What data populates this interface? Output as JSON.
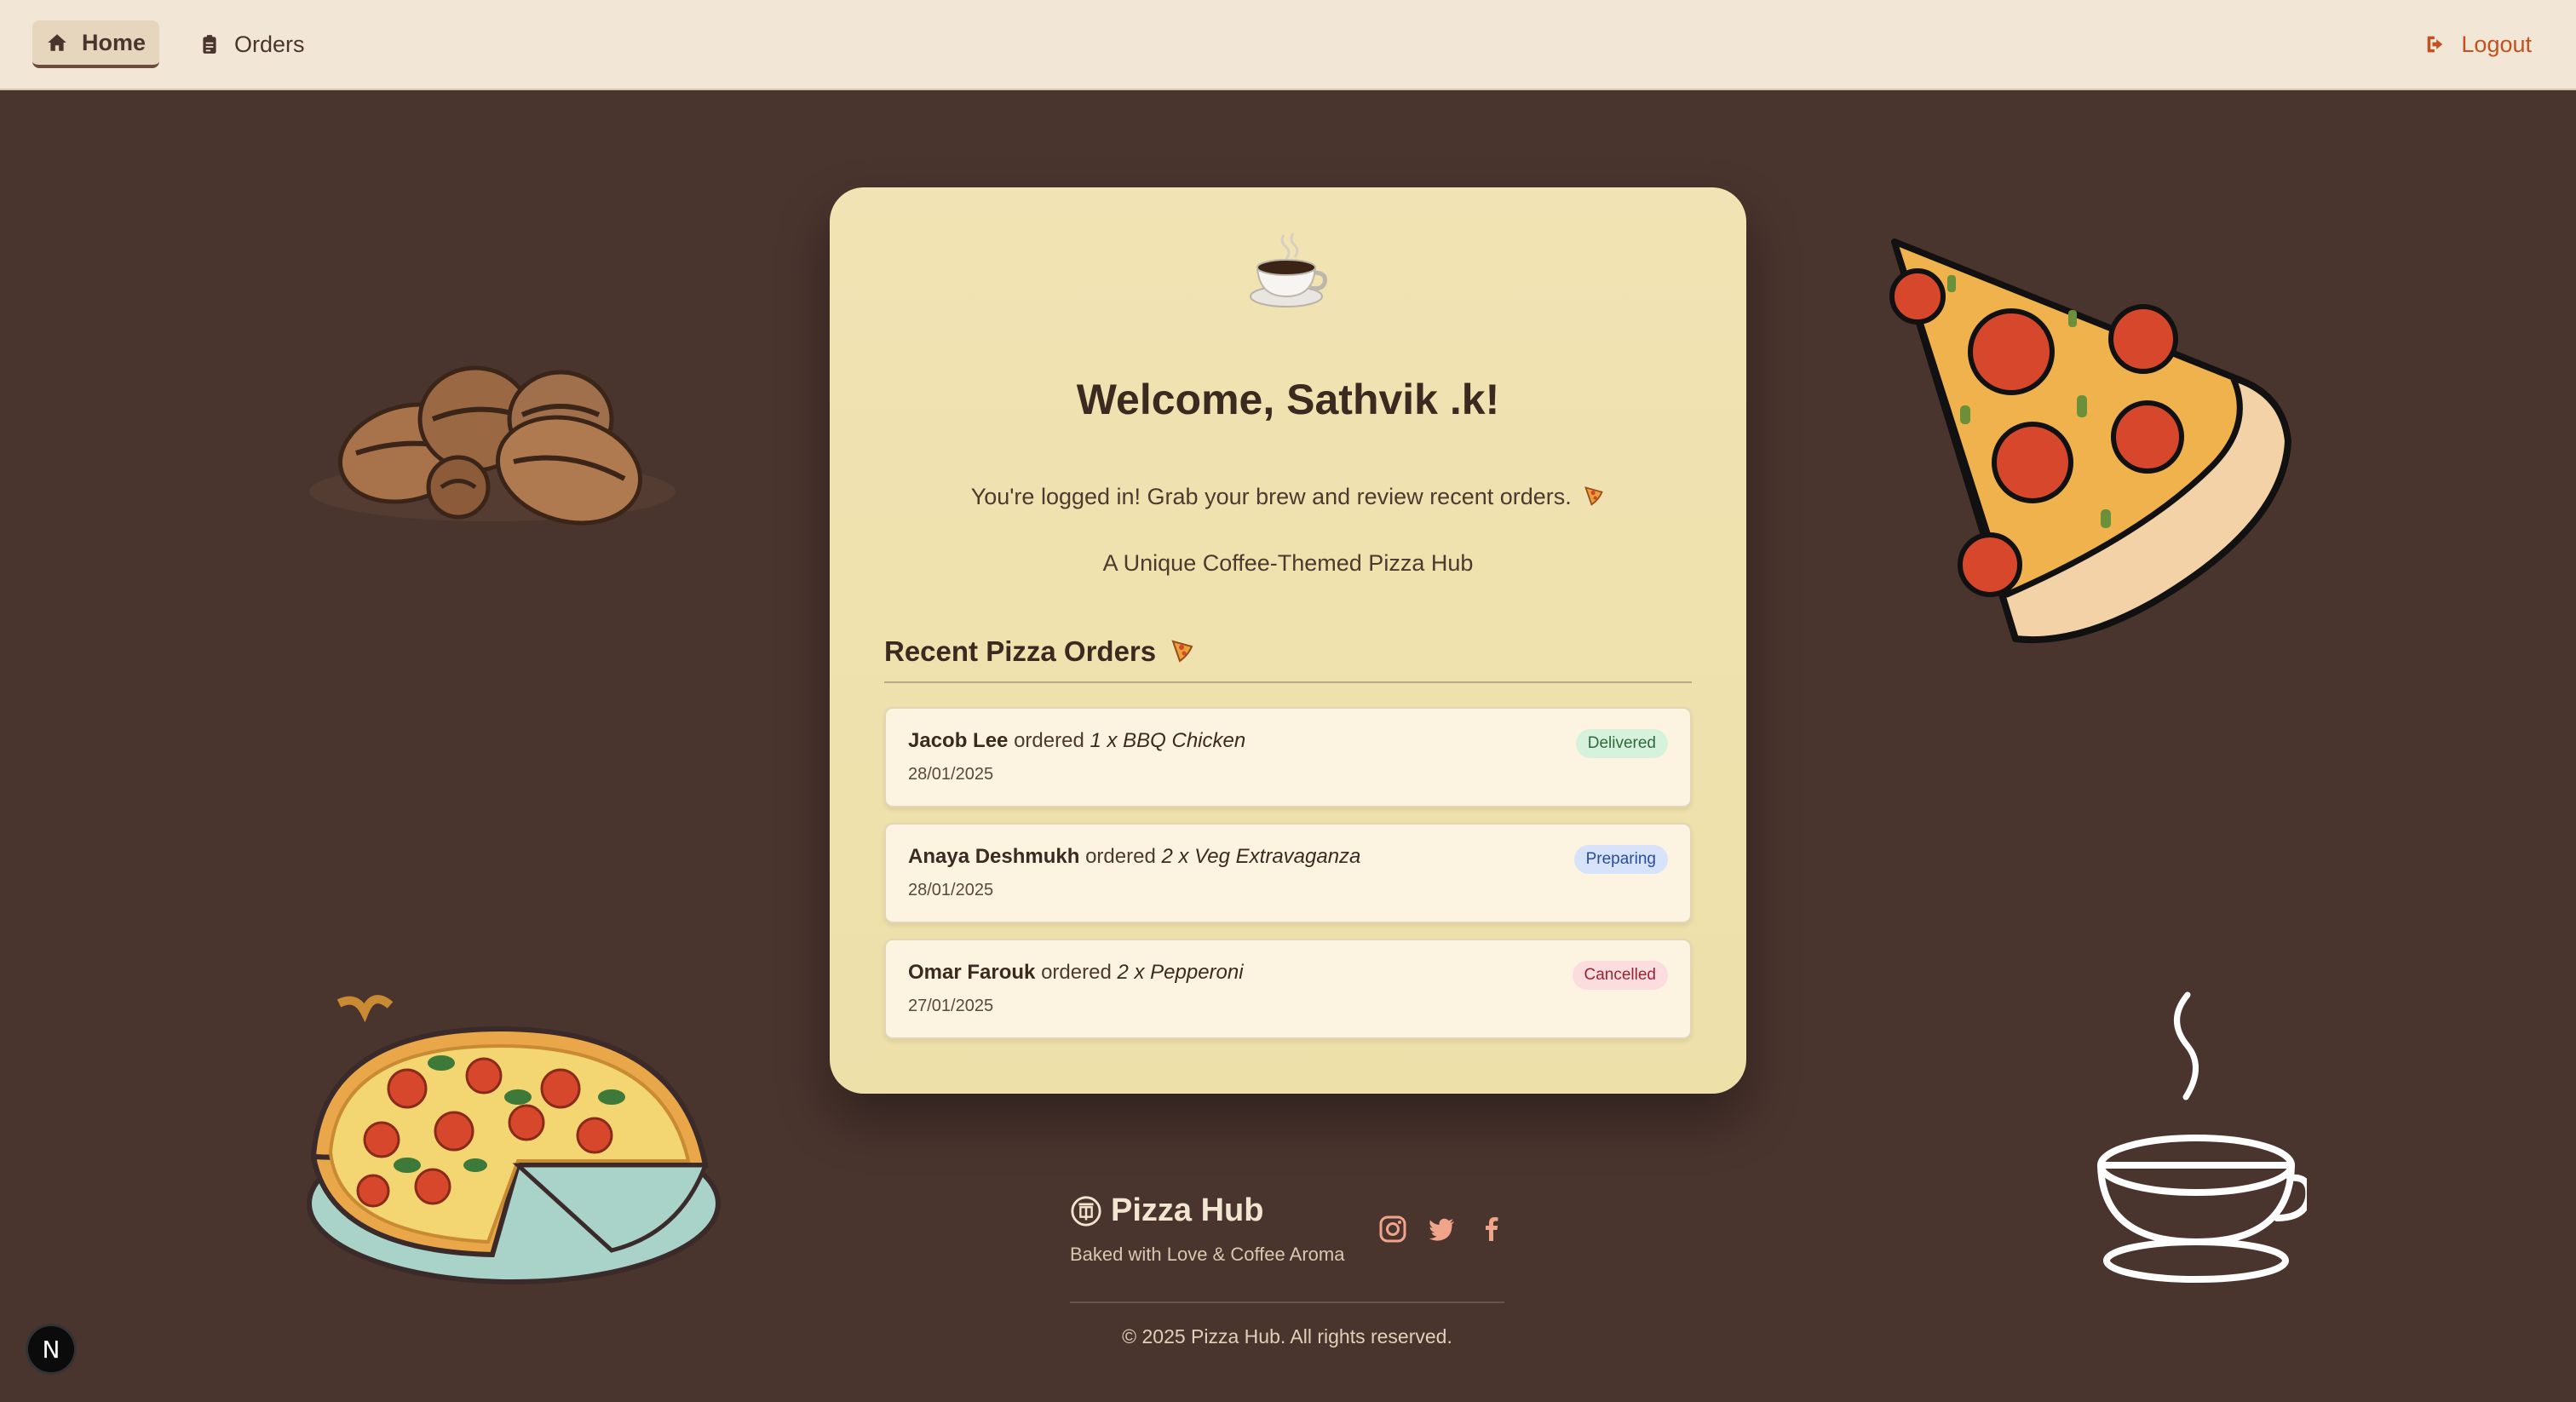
{
  "nav": {
    "home_label": "Home",
    "orders_label": "Orders",
    "logout_label": "Logout"
  },
  "card": {
    "welcome": "Welcome, Sathvik .k!",
    "subtitle": "You're logged in! Grab your brew and review recent orders.",
    "tagline": "A Unique Coffee-Themed Pizza Hub",
    "recent_title": "Recent Pizza Orders"
  },
  "orders": [
    {
      "customer": "Jacob Lee",
      "verb": "ordered",
      "item": "1 x BBQ Chicken",
      "date": "28/01/2025",
      "status": "Delivered",
      "status_color": "#2e6a3a"
    },
    {
      "customer": "Anaya Deshmukh",
      "verb": "ordered",
      "item": "2 x Veg Extravaganza",
      "date": "28/01/2025",
      "status": "Preparing",
      "status_color": "#2a4d9c"
    },
    {
      "customer": "Omar Farouk",
      "verb": "ordered",
      "item": "2 x Pepperoni",
      "date": "27/01/2025",
      "status": "Cancelled",
      "status_color": "#9a2532"
    }
  ],
  "footer": {
    "brand": "Pizza Hub",
    "tagline": "Baked with Love & Coffee Aroma",
    "copyright": "© 2025 Pizza Hub. All rights reserved.",
    "social": [
      "instagram-icon",
      "twitter-icon",
      "facebook-icon"
    ]
  },
  "dev_badge": "N",
  "colors": {
    "background": "#4a342e",
    "topbar": "#f2e7d6",
    "card": "#efe1ad",
    "accent": "#c4501f"
  }
}
